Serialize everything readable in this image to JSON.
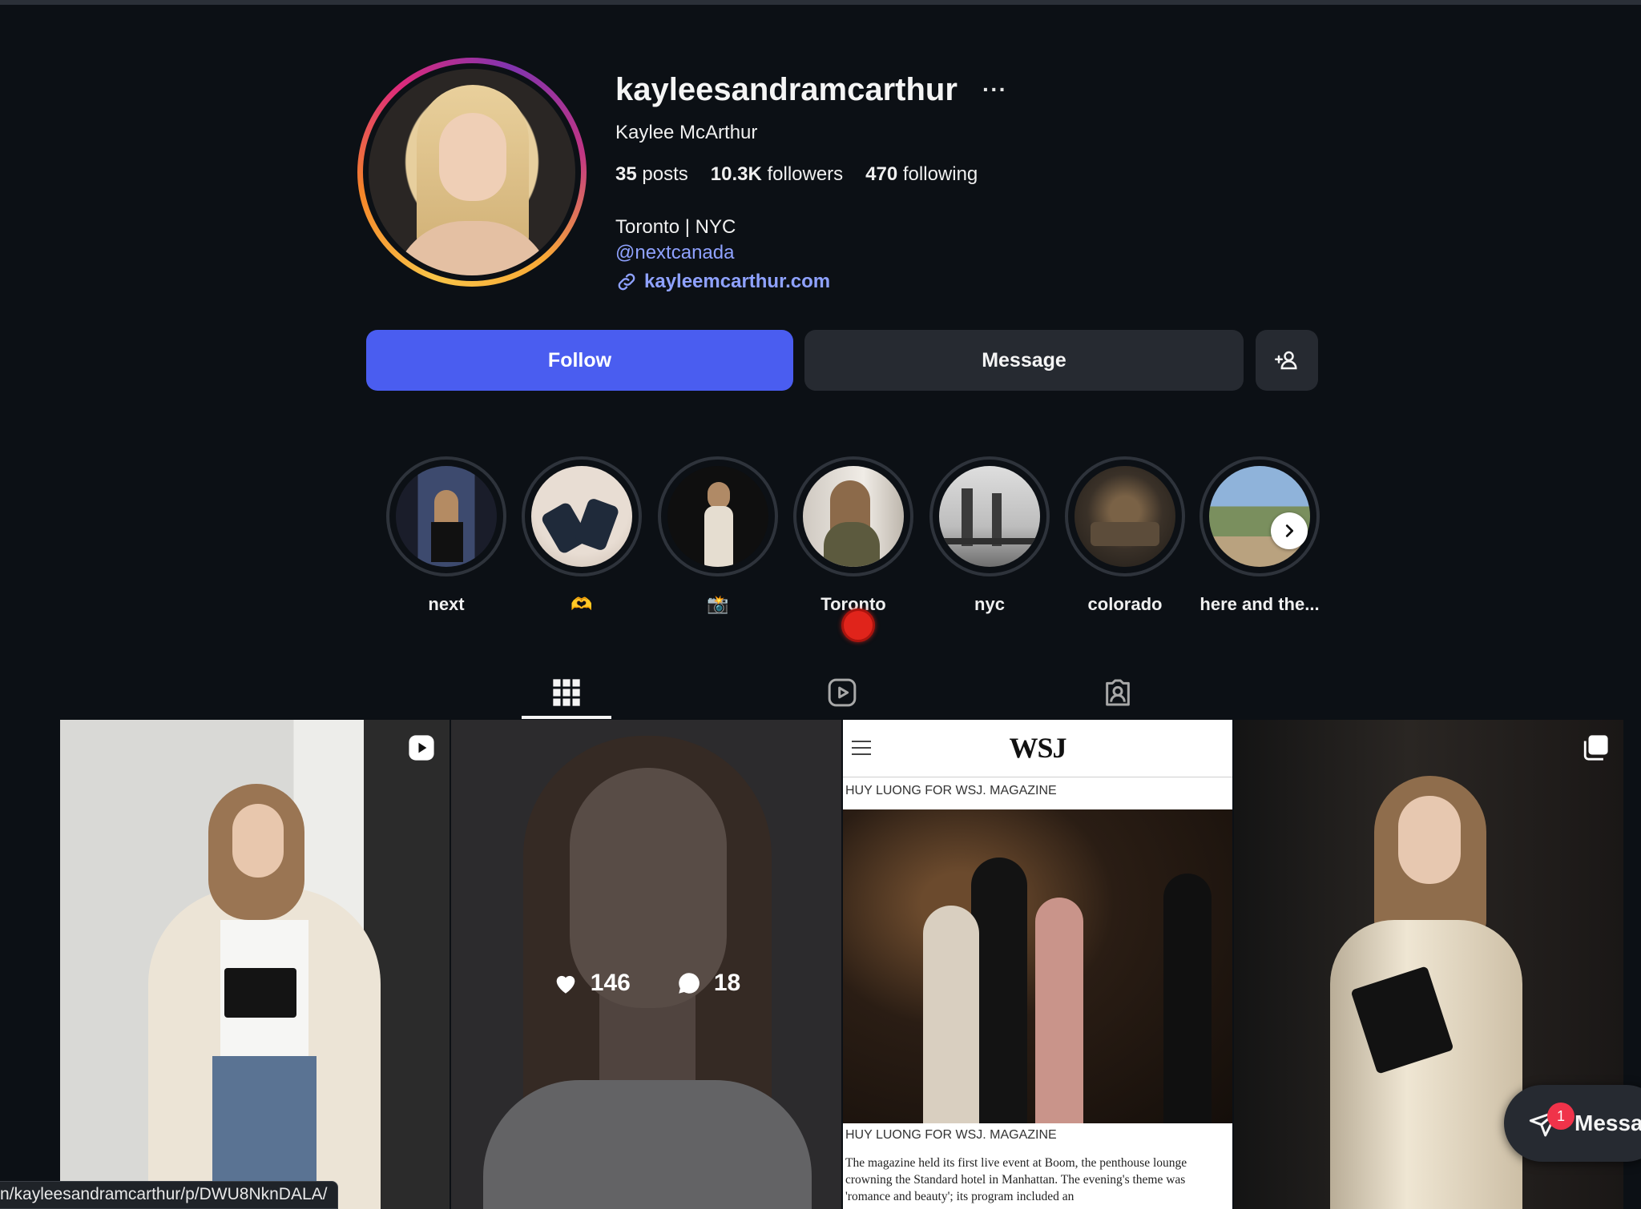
{
  "profile": {
    "username": "kayleesandramcarthur",
    "more_icon": "···",
    "full_name": "Kaylee McArthur",
    "stats": {
      "posts_count": "35",
      "posts_label": "posts",
      "followers_count": "10.3K",
      "followers_label": "followers",
      "following_count": "470",
      "following_label": "following"
    },
    "bio": "Toronto | NYC",
    "mention": "@nextcanada",
    "website": "kayleemcarthur.com"
  },
  "actions": {
    "follow_label": "Follow",
    "message_label": "Message",
    "add_user_icon": "add-user-icon"
  },
  "highlights": [
    {
      "label": "next"
    },
    {
      "label": "🫶"
    },
    {
      "label": "📸"
    },
    {
      "label": "Toronto"
    },
    {
      "label": "nyc"
    },
    {
      "label": "colorado"
    },
    {
      "label": "here and the..."
    }
  ],
  "tabs": [
    {
      "name": "posts",
      "icon": "grid-icon",
      "active": true
    },
    {
      "name": "reels",
      "icon": "reels-icon",
      "active": false
    },
    {
      "name": "tagged",
      "icon": "tagged-icon",
      "active": false
    }
  ],
  "posts": {
    "hover": {
      "likes": "146",
      "comments": "18"
    },
    "wsj": {
      "logo": "WSJ",
      "credit_top": "HUY LUONG FOR WSJ. MAGAZINE",
      "credit_bottom": "HUY LUONG FOR WSJ. MAGAZINE",
      "body": "The magazine held its first live event at Boom, the penthouse lounge crowning the Standard hotel in Manhattan. The evening's theme was 'romance and beauty'; its program included an"
    }
  },
  "status_url": "n/kayleesandramcarthur/p/DWU8NknDALA/",
  "messages_float": {
    "label": "Messa",
    "badge": "1"
  },
  "colors": {
    "background": "#0c1015",
    "follow_button": "#4a5df0",
    "secondary_button": "#262a31",
    "link": "#8fa2ff",
    "notification": "#f0334a"
  }
}
